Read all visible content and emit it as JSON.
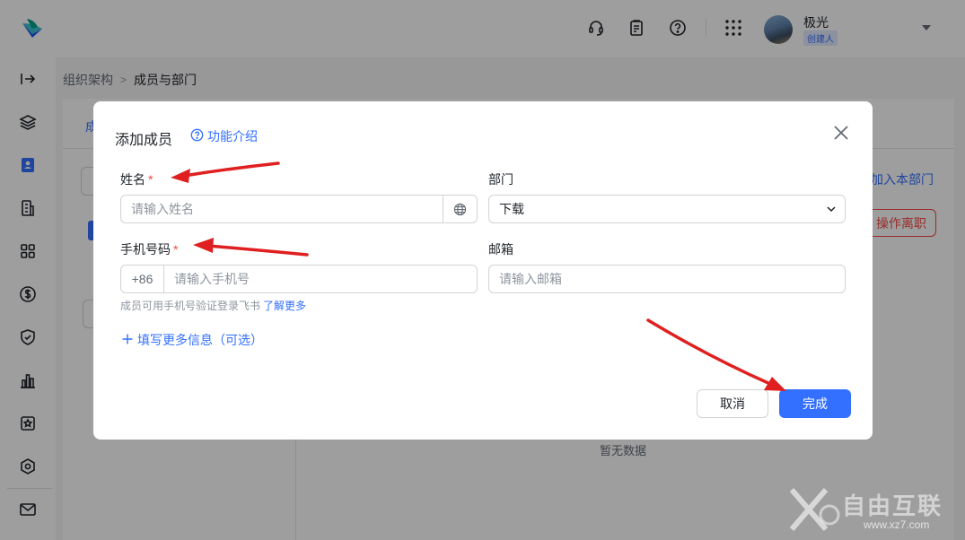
{
  "topbar": {
    "user_name": "极光",
    "user_role": "创建人"
  },
  "breadcrumb": {
    "parent": "组织架构",
    "current": "成员与部门"
  },
  "background": {
    "tab_partial": "成",
    "join_dept": "加入本部门",
    "leave": "操作离职",
    "empty": "暂无数据"
  },
  "modal": {
    "title": "添加成员",
    "help": "功能介绍",
    "name_label": "姓名",
    "name_placeholder": "请输入姓名",
    "dept_label": "部门",
    "dept_value": "下载",
    "phone_label": "手机号码",
    "phone_prefix": "+86",
    "phone_placeholder": "请输入手机号",
    "email_label": "邮箱",
    "email_placeholder": "请输入邮箱",
    "hint": "成员可用手机号验证登录飞书",
    "hint_link": "了解更多",
    "more_info": "填写更多信息（可选）",
    "cancel": "取消",
    "done": "完成",
    "required_mark": "*"
  },
  "watermark": {
    "text": "自由互联",
    "url": "www.xz7.com"
  },
  "colors": {
    "accent": "#3370ff",
    "danger": "#f54a45",
    "annotation_arrow": "#e02020"
  }
}
